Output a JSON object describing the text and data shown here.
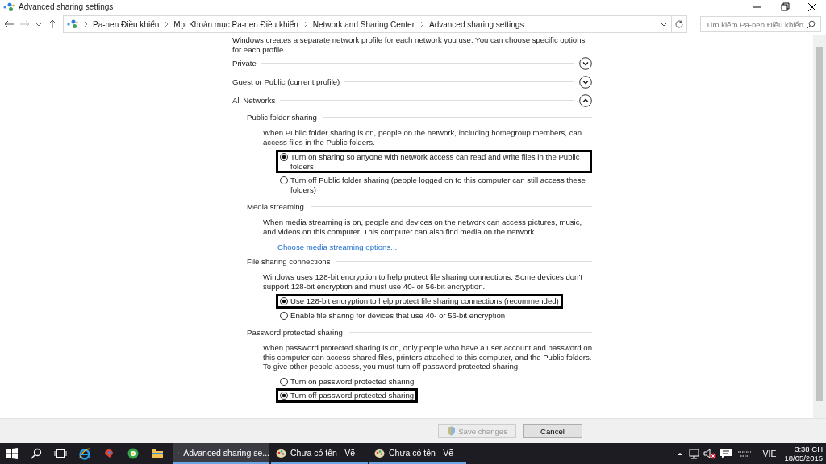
{
  "window": {
    "title": "Advanced sharing settings"
  },
  "address_bar": {
    "breadcrumbs": [
      "Pa-nen Điều khiển",
      "Mọi Khoản mục Pa-nen Điều khiển",
      "Network and Sharing Center",
      "Advanced sharing settings"
    ],
    "search_placeholder": "Tìm kiếm Pa-nen Điều khiển"
  },
  "intro": "Windows creates a separate network profile for each network you use. You can choose specific options for each profile.",
  "profiles": [
    {
      "name": "Private",
      "expanded": false
    },
    {
      "name": "Guest or Public (current profile)",
      "expanded": false
    },
    {
      "name": "All Networks",
      "expanded": true,
      "sections": [
        {
          "heading": "Public folder sharing",
          "description": "When Public folder sharing is on, people on the network, including homegroup members, can access files in the Public folders.",
          "options": [
            {
              "label": "Turn on sharing so anyone with network access can read and write files in the Public folders",
              "selected": true,
              "highlighted": true
            },
            {
              "label": "Turn off Public folder sharing (people logged on to this computer can still access these folders)",
              "selected": false,
              "highlighted": false
            }
          ]
        },
        {
          "heading": "Media streaming",
          "description": "When media streaming is on, people and devices on the network can access pictures, music, and videos on this computer. This computer can also find media on the network.",
          "link": "Choose media streaming options..."
        },
        {
          "heading": "File sharing connections",
          "description": "Windows uses 128-bit encryption to help protect file sharing connections. Some devices don't support 128-bit encryption and must use 40- or 56-bit encryption.",
          "options": [
            {
              "label": "Use 128-bit encryption to help protect file sharing connections (recommended)",
              "selected": true,
              "highlighted": true
            },
            {
              "label": "Enable file sharing for devices that use 40- or 56-bit encryption",
              "selected": false,
              "highlighted": false
            }
          ]
        },
        {
          "heading": "Password protected sharing",
          "description": "When password protected sharing is on, only people who have a user account and password on this computer can access shared files, printers attached to this computer, and the Public folders. To give other people access, you must turn off password protected sharing.",
          "options": [
            {
              "label": "Turn on password protected sharing",
              "selected": false,
              "highlighted": false
            },
            {
              "label": "Turn off password protected sharing",
              "selected": true,
              "highlighted": true
            }
          ]
        }
      ]
    }
  ],
  "buttons": [
    {
      "label": "Save changes",
      "disabled": true,
      "kind": "shield"
    },
    {
      "label": "Cancel",
      "disabled": false,
      "kind": "plain"
    }
  ],
  "taskbar": {
    "tasks": [
      {
        "label": "Advanced sharing se...",
        "selected": true
      },
      {
        "label": "Chưa có tên - Vẽ",
        "selected": false
      },
      {
        "label": "Chưa có tên - Vẽ",
        "selected": false
      }
    ],
    "language": "VIE",
    "time": "3:38 CH",
    "date": "18/05/2015"
  }
}
